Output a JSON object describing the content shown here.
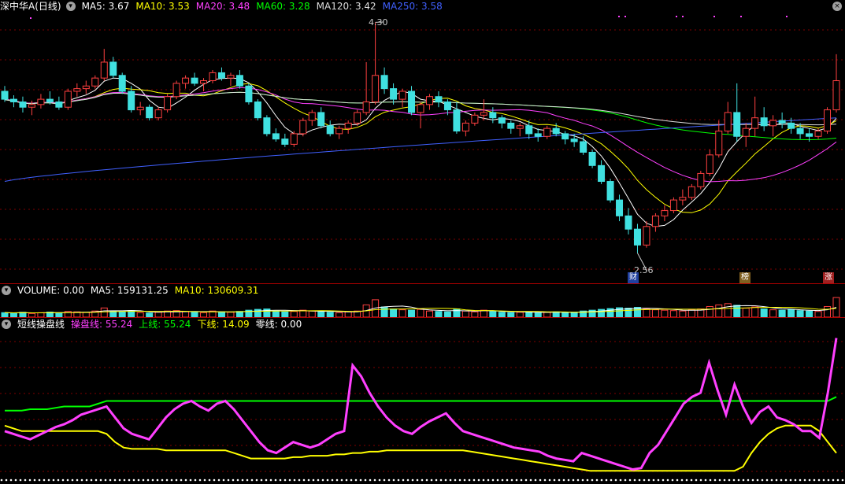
{
  "price_header": {
    "title": "深中华A(日线)",
    "items": [
      {
        "label": "MA5: 3.67",
        "color": "#ffffff"
      },
      {
        "label": "MA10: 3.53",
        "color": "#ffff00"
      },
      {
        "label": "MA20: 3.48",
        "color": "#ff40ff"
      },
      {
        "label": "MA60: 3.28",
        "color": "#00ff00"
      },
      {
        "label": "MA120: 3.42",
        "color": "#dddddd"
      },
      {
        "label": "MA250: 3.58",
        "color": "#4060ff"
      }
    ],
    "high_label": "4.30",
    "low_label": "2.56"
  },
  "badges": {
    "cai": "财",
    "bang": "榜",
    "zhang": "涨"
  },
  "volume_header": {
    "title": "VOLUME: 0.00",
    "items": [
      {
        "label": "MA5: 159131.25",
        "color": "#ffffff"
      },
      {
        "label": "MA10: 130609.31",
        "color": "#ffff00"
      }
    ]
  },
  "indicator_header": {
    "title": "短线操盘线",
    "items": [
      {
        "label": "操盘线: 55.24",
        "color": "#ff40ff"
      },
      {
        "label": "上线: 55.24",
        "color": "#00ff00"
      },
      {
        "label": "下线: 14.09",
        "color": "#ffff00"
      },
      {
        "label": "零线: 0.00",
        "color": "#ffffff"
      }
    ]
  },
  "colors": {
    "up": "#ff4040",
    "down": "#40e0e0",
    "grid": "#800000"
  },
  "chart_data": {
    "type": "line",
    "candles_ohlc": [
      [
        3.78,
        3.82,
        3.7,
        3.72
      ],
      [
        3.72,
        3.75,
        3.66,
        3.7
      ],
      [
        3.7,
        3.74,
        3.62,
        3.66
      ],
      [
        3.66,
        3.71,
        3.6,
        3.68
      ],
      [
        3.68,
        3.76,
        3.65,
        3.72
      ],
      [
        3.72,
        3.78,
        3.68,
        3.7
      ],
      [
        3.7,
        3.74,
        3.64,
        3.66
      ],
      [
        3.66,
        3.8,
        3.64,
        3.78
      ],
      [
        3.78,
        3.84,
        3.74,
        3.8
      ],
      [
        3.8,
        3.86,
        3.76,
        3.82
      ],
      [
        3.82,
        3.9,
        3.8,
        3.88
      ],
      [
        3.88,
        4.1,
        3.86,
        4.0
      ],
      [
        4.0,
        4.04,
        3.88,
        3.9
      ],
      [
        3.9,
        3.92,
        3.76,
        3.78
      ],
      [
        3.78,
        3.82,
        3.62,
        3.64
      ],
      [
        3.64,
        3.7,
        3.6,
        3.66
      ],
      [
        3.66,
        3.68,
        3.56,
        3.58
      ],
      [
        3.58,
        3.66,
        3.56,
        3.64
      ],
      [
        3.64,
        3.76,
        3.62,
        3.74
      ],
      [
        3.74,
        3.86,
        3.72,
        3.84
      ],
      [
        3.84,
        3.9,
        3.8,
        3.88
      ],
      [
        3.88,
        3.92,
        3.82,
        3.84
      ],
      [
        3.84,
        3.88,
        3.78,
        3.86
      ],
      [
        3.86,
        3.94,
        3.84,
        3.92
      ],
      [
        3.92,
        3.96,
        3.86,
        3.88
      ],
      [
        3.88,
        3.92,
        3.82,
        3.9
      ],
      [
        3.9,
        3.94,
        3.8,
        3.82
      ],
      [
        3.82,
        3.84,
        3.68,
        3.7
      ],
      [
        3.7,
        3.72,
        3.56,
        3.58
      ],
      [
        3.58,
        3.6,
        3.44,
        3.46
      ],
      [
        3.46,
        3.5,
        3.4,
        3.42
      ],
      [
        3.42,
        3.46,
        3.36,
        3.38
      ],
      [
        3.38,
        3.48,
        3.36,
        3.46
      ],
      [
        3.46,
        3.58,
        3.44,
        3.56
      ],
      [
        3.56,
        3.64,
        3.52,
        3.62
      ],
      [
        3.62,
        3.66,
        3.5,
        3.52
      ],
      [
        3.52,
        3.56,
        3.44,
        3.46
      ],
      [
        3.46,
        3.52,
        3.42,
        3.5
      ],
      [
        3.5,
        3.56,
        3.46,
        3.54
      ],
      [
        3.54,
        3.64,
        3.52,
        3.62
      ],
      [
        3.62,
        4.0,
        3.6,
        3.7
      ],
      [
        3.7,
        4.3,
        3.68,
        3.9
      ],
      [
        3.9,
        3.96,
        3.76,
        3.8
      ],
      [
        3.8,
        3.84,
        3.68,
        3.72
      ],
      [
        3.72,
        3.8,
        3.66,
        3.78
      ],
      [
        3.78,
        3.82,
        3.6,
        3.62
      ],
      [
        3.62,
        3.7,
        3.5,
        3.68
      ],
      [
        3.68,
        3.76,
        3.64,
        3.74
      ],
      [
        3.74,
        3.78,
        3.66,
        3.7
      ],
      [
        3.7,
        3.72,
        3.6,
        3.64
      ],
      [
        3.64,
        3.7,
        3.46,
        3.48
      ],
      [
        3.48,
        3.56,
        3.44,
        3.54
      ],
      [
        3.54,
        3.62,
        3.52,
        3.6
      ],
      [
        3.6,
        3.72,
        3.56,
        3.62
      ],
      [
        3.62,
        3.66,
        3.54,
        3.58
      ],
      [
        3.58,
        3.6,
        3.5,
        3.54
      ],
      [
        3.54,
        3.56,
        3.46,
        3.5
      ],
      [
        3.5,
        3.54,
        3.44,
        3.52
      ],
      [
        3.52,
        3.56,
        3.42,
        3.46
      ],
      [
        3.46,
        3.5,
        3.4,
        3.44
      ],
      [
        3.44,
        3.52,
        3.42,
        3.5
      ],
      [
        3.5,
        3.54,
        3.44,
        3.46
      ],
      [
        3.46,
        3.48,
        3.38,
        3.42
      ],
      [
        3.42,
        3.46,
        3.36,
        3.4
      ],
      [
        3.4,
        3.44,
        3.3,
        3.32
      ],
      [
        3.32,
        3.34,
        3.2,
        3.22
      ],
      [
        3.22,
        3.26,
        3.08,
        3.1
      ],
      [
        3.1,
        3.12,
        2.94,
        2.96
      ],
      [
        2.96,
        3.0,
        2.8,
        2.84
      ],
      [
        2.84,
        2.9,
        2.7,
        2.74
      ],
      [
        2.74,
        2.78,
        2.56,
        2.62
      ],
      [
        2.62,
        2.8,
        2.6,
        2.76
      ],
      [
        2.76,
        2.86,
        2.72,
        2.84
      ],
      [
        2.84,
        2.92,
        2.8,
        2.88
      ],
      [
        2.88,
        2.98,
        2.86,
        2.96
      ],
      [
        2.96,
        3.04,
        2.92,
        2.98
      ],
      [
        2.98,
        3.08,
        2.96,
        3.06
      ],
      [
        3.06,
        3.18,
        3.04,
        3.16
      ],
      [
        3.16,
        3.34,
        3.14,
        3.3
      ],
      [
        3.3,
        3.56,
        3.28,
        3.48
      ],
      [
        3.48,
        3.7,
        3.46,
        3.62
      ],
      [
        3.62,
        3.84,
        3.4,
        3.44
      ],
      [
        3.44,
        3.54,
        3.36,
        3.5
      ],
      [
        3.5,
        3.74,
        3.44,
        3.58
      ],
      [
        3.58,
        3.66,
        3.48,
        3.52
      ],
      [
        3.52,
        3.6,
        3.44,
        3.56
      ],
      [
        3.56,
        3.62,
        3.5,
        3.54
      ],
      [
        3.54,
        3.58,
        3.46,
        3.5
      ],
      [
        3.5,
        3.54,
        3.42,
        3.46
      ],
      [
        3.46,
        3.5,
        3.4,
        3.44
      ],
      [
        3.44,
        3.5,
        3.42,
        3.48
      ],
      [
        3.48,
        3.66,
        3.46,
        3.64
      ],
      [
        3.64,
        4.06,
        3.62,
        3.86
      ]
    ],
    "ma_series": [
      {
        "name": "MA5",
        "color": "#ffffff"
      },
      {
        "name": "MA10",
        "color": "#ffff00"
      },
      {
        "name": "MA20",
        "color": "#ff40ff"
      },
      {
        "name": "MA60",
        "color": "#00ff00"
      },
      {
        "name": "MA120",
        "color": "#dddddd"
      },
      {
        "name": "MA250",
        "color": "#4060ff"
      }
    ],
    "price_range": [
      2.45,
      4.35
    ],
    "volume": [
      22,
      20,
      24,
      18,
      22,
      25,
      20,
      28,
      26,
      24,
      30,
      45,
      30,
      26,
      32,
      22,
      20,
      24,
      30,
      32,
      28,
      24,
      22,
      30,
      26,
      24,
      28,
      34,
      38,
      40,
      30,
      26,
      28,
      34,
      30,
      26,
      24,
      22,
      26,
      30,
      60,
      85,
      50,
      40,
      36,
      34,
      38,
      30,
      28,
      26,
      40,
      30,
      26,
      34,
      28,
      24,
      22,
      24,
      26,
      22,
      24,
      26,
      22,
      24,
      30,
      34,
      38,
      42,
      46,
      44,
      48,
      40,
      36,
      34,
      32,
      30,
      36,
      40,
      52,
      60,
      66,
      58,
      44,
      50,
      40,
      36,
      34,
      38,
      32,
      30,
      28,
      52,
      96
    ],
    "volume_max": 100,
    "indicator": {
      "range": [
        0,
        100
      ],
      "operator_line": [
        30,
        28,
        26,
        24,
        27,
        30,
        33,
        35,
        38,
        42,
        44,
        46,
        48,
        40,
        32,
        28,
        26,
        24,
        32,
        40,
        46,
        50,
        52,
        48,
        45,
        50,
        52,
        46,
        38,
        30,
        22,
        16,
        14,
        18,
        22,
        20,
        18,
        20,
        24,
        28,
        30,
        78,
        70,
        58,
        48,
        40,
        34,
        30,
        28,
        33,
        37,
        40,
        43,
        36,
        30,
        28,
        26,
        24,
        22,
        20,
        18,
        17,
        16,
        15,
        12,
        10,
        9,
        8,
        14,
        12,
        10,
        8,
        6,
        4,
        2,
        3,
        14,
        20,
        30,
        40,
        50,
        55,
        58,
        80,
        60,
        42,
        64,
        48,
        36,
        44,
        48,
        40,
        38,
        35,
        30,
        30,
        25,
        58,
        98
      ],
      "upper_line": [
        45,
        45,
        45,
        46,
        46,
        46,
        47,
        48,
        48,
        48,
        48,
        50,
        52,
        52,
        52,
        52,
        52,
        52,
        52,
        52,
        52,
        52,
        52,
        52,
        52,
        52,
        52,
        52,
        52,
        52,
        52,
        52,
        52,
        52,
        52,
        52,
        52,
        52,
        52,
        52,
        52,
        52,
        52,
        52,
        52,
        52,
        52,
        52,
        52,
        52,
        52,
        52,
        52,
        52,
        52,
        52,
        52,
        52,
        52,
        52,
        52,
        52,
        52,
        52,
        52,
        52,
        52,
        52,
        52,
        52,
        52,
        52,
        52,
        52,
        52,
        52,
        52,
        52,
        52,
        52,
        52,
        52,
        52,
        52,
        52,
        52,
        52,
        52,
        52,
        52,
        52,
        52,
        52,
        52,
        52,
        52,
        52,
        52,
        55
      ],
      "lower_line": [
        34,
        32,
        30,
        30,
        30,
        30,
        30,
        30,
        30,
        30,
        30,
        30,
        28,
        22,
        18,
        17,
        17,
        17,
        17,
        16,
        16,
        16,
        16,
        16,
        16,
        16,
        16,
        14,
        12,
        10,
        10,
        10,
        10,
        10,
        11,
        11,
        12,
        12,
        12,
        13,
        13,
        14,
        14,
        15,
        15,
        16,
        16,
        16,
        16,
        16,
        16,
        16,
        16,
        16,
        16,
        15,
        14,
        13,
        12,
        11,
        10,
        9,
        8,
        7,
        6,
        5,
        4,
        3,
        2,
        1,
        1,
        1,
        1,
        1,
        1,
        1,
        1,
        1,
        1,
        1,
        1,
        1,
        1,
        1,
        1,
        1,
        1,
        4,
        14,
        22,
        28,
        32,
        34,
        34,
        34,
        34,
        30,
        22,
        14
      ]
    }
  }
}
